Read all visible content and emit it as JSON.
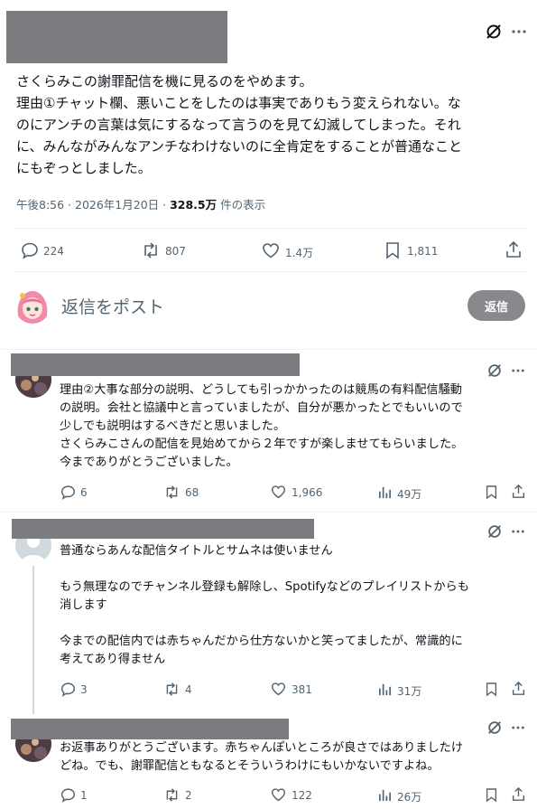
{
  "main_post": {
    "text_lines": [
      "さくらみこの謝罪配信を機に見るのをやめます。",
      "理由①チャット欄、悪いことをしたのは事実でありもう変えられない。な",
      "のにアンチの言葉は気にするなって言うのを見て幻滅してしまった。それ",
      "に、みんながみんなアンチなわけないのに全肯定をすることが普通なこと",
      "にもぞっとしました。"
    ],
    "meta_time": "午後8:56 · 2026年1月20日 · ",
    "meta_views": "328.5万",
    "meta_views_suffix": " 件の表示",
    "replies": "224",
    "reposts": "807",
    "likes": "1.4万",
    "bookmarks": "1,811"
  },
  "composer": {
    "placeholder": "返信をポスト",
    "reply_button": "返信"
  },
  "replies": [
    {
      "lines": [
        "理由②大事な部分の説明、どうしても引っかかったのは競馬の有料配信騒動",
        "の説明。会社と協議中と言っていましたが、自分が悪かったとでもいいので",
        "少しでも説明はするべきだと思いました。",
        "さくらみこさんの配信を見始めてから２年ですが楽しませてもらいました。",
        "今までありがとうございました。"
      ],
      "replies": "6",
      "reposts": "68",
      "likes": "1,966",
      "views": "49万"
    },
    {
      "lines": [
        "普通ならあんな配信タイトルとサムネは使いません",
        "",
        "もう無理なのでチャンネル登録も解除し、Spotifyなどのプレイリストからも",
        "消します",
        "",
        "今までの配信内では赤ちゃんだから仕方ないかと笑ってましたが、常識的に",
        "考えてあり得ません"
      ],
      "replies": "3",
      "reposts": "4",
      "likes": "381",
      "views": "31万"
    },
    {
      "lines": [
        "お返事ありがとうございます。赤ちゃんぽいところが良さではありましたけ",
        "どね。でも、謝罪配信ともなるとそういうわけにもいかないですよね。"
      ],
      "replies": "1",
      "reposts": "2",
      "likes": "122",
      "views": "26万"
    }
  ],
  "colors": {
    "text": "#0f1419",
    "muted": "#536471",
    "redaction": "#7b7c7f",
    "reply_button_bg": "#87898c",
    "thread_line": "#cfd9de",
    "divider": "#eff3f4"
  },
  "icons": [
    "grok-icon",
    "more-icon",
    "reply-icon",
    "repost-icon",
    "like-icon",
    "bookmark-icon",
    "share-icon",
    "views-icon",
    "avatar-icon"
  ]
}
